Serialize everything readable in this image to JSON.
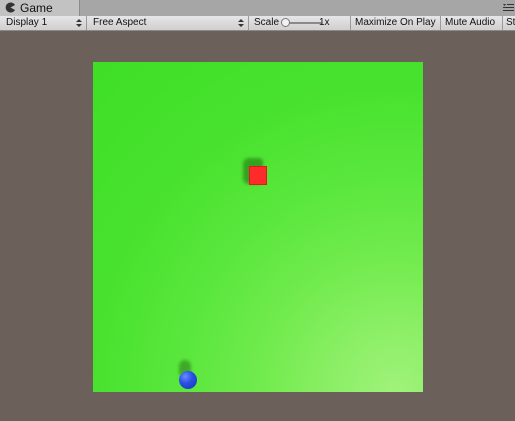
{
  "window": {
    "tab_label": "Game",
    "tab_icon": "pacman-icon",
    "menu_icon": "tab-menu-icon"
  },
  "toolbar": {
    "display_label": "Display 1",
    "aspect_label": "Free Aspect",
    "scale_label": "Scale",
    "scale_value": "1x",
    "maximize_label": "Maximize On Play",
    "mute_label": "Mute Audio",
    "stats_label": "St"
  },
  "colors": {
    "editor_background": "#6b615a",
    "ground_green": "#3fdf26",
    "cube_red": "#ff2a2a",
    "ball_blue": "#2a50e6"
  }
}
